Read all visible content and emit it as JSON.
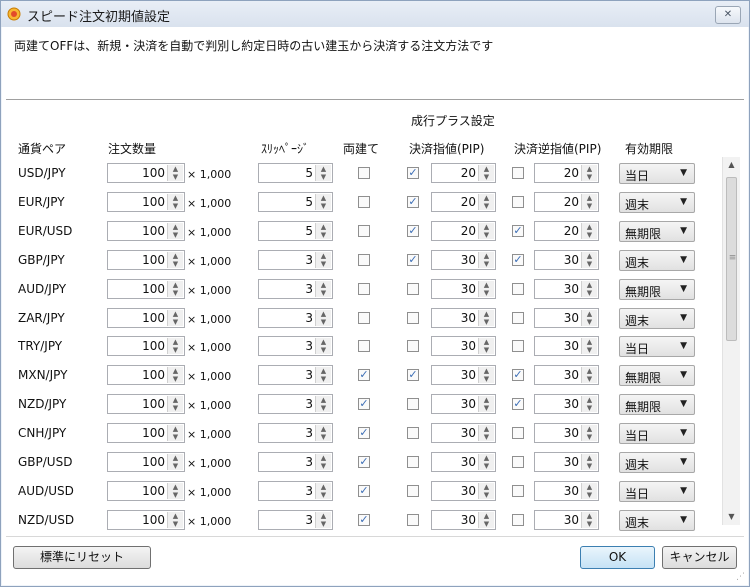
{
  "window": {
    "title": "スピード注文初期値設定",
    "close_label": "✕"
  },
  "description": "両建てOFFは、新規・決済を自動で判別し約定日時の古い建玉から決済する注文方法です",
  "section_header": "成行プラス設定",
  "columns": {
    "pair": "通貨ペア",
    "qty": "注文数量",
    "slippage": "ｽﾘｯﾍﾟｰｼﾞ",
    "hedge": "両建て",
    "limit": "決済指値(PIP)",
    "stop": "決済逆指値(PIP)",
    "expiry": "有効期限"
  },
  "multiplier_label": "× 1,000",
  "rows": [
    {
      "pair": "USD/JPY",
      "qty": "100",
      "slip": "5",
      "hedge": false,
      "limit_on": true,
      "limit": "20",
      "stop_on": false,
      "stop": "20",
      "expiry": "当日"
    },
    {
      "pair": "EUR/JPY",
      "qty": "100",
      "slip": "5",
      "hedge": false,
      "limit_on": true,
      "limit": "20",
      "stop_on": false,
      "stop": "20",
      "expiry": "週末"
    },
    {
      "pair": "EUR/USD",
      "qty": "100",
      "slip": "5",
      "hedge": false,
      "limit_on": true,
      "limit": "20",
      "stop_on": true,
      "stop": "20",
      "expiry": "無期限"
    },
    {
      "pair": "GBP/JPY",
      "qty": "100",
      "slip": "3",
      "hedge": false,
      "limit_on": true,
      "limit": "30",
      "stop_on": true,
      "stop": "30",
      "expiry": "週末"
    },
    {
      "pair": "AUD/JPY",
      "qty": "100",
      "slip": "3",
      "hedge": false,
      "limit_on": false,
      "limit": "30",
      "stop_on": false,
      "stop": "30",
      "expiry": "無期限"
    },
    {
      "pair": "ZAR/JPY",
      "qty": "100",
      "slip": "3",
      "hedge": false,
      "limit_on": false,
      "limit": "30",
      "stop_on": false,
      "stop": "30",
      "expiry": "週末"
    },
    {
      "pair": "TRY/JPY",
      "qty": "100",
      "slip": "3",
      "hedge": false,
      "limit_on": false,
      "limit": "30",
      "stop_on": false,
      "stop": "30",
      "expiry": "当日"
    },
    {
      "pair": "MXN/JPY",
      "qty": "100",
      "slip": "3",
      "hedge": true,
      "limit_on": true,
      "limit": "30",
      "stop_on": true,
      "stop": "30",
      "expiry": "無期限"
    },
    {
      "pair": "NZD/JPY",
      "qty": "100",
      "slip": "3",
      "hedge": true,
      "limit_on": false,
      "limit": "30",
      "stop_on": true,
      "stop": "30",
      "expiry": "無期限"
    },
    {
      "pair": "CNH/JPY",
      "qty": "100",
      "slip": "3",
      "hedge": true,
      "limit_on": false,
      "limit": "30",
      "stop_on": false,
      "stop": "30",
      "expiry": "当日"
    },
    {
      "pair": "GBP/USD",
      "qty": "100",
      "slip": "3",
      "hedge": true,
      "limit_on": false,
      "limit": "30",
      "stop_on": false,
      "stop": "30",
      "expiry": "週末"
    },
    {
      "pair": "AUD/USD",
      "qty": "100",
      "slip": "3",
      "hedge": true,
      "limit_on": false,
      "limit": "30",
      "stop_on": false,
      "stop": "30",
      "expiry": "当日"
    },
    {
      "pair": "NZD/USD",
      "qty": "100",
      "slip": "3",
      "hedge": true,
      "limit_on": false,
      "limit": "30",
      "stop_on": false,
      "stop": "30",
      "expiry": "週末"
    }
  ],
  "buttons": {
    "reset": "標準にリセット",
    "ok": "OK",
    "cancel": "キャンセル"
  },
  "icons": {
    "spinner": "up-down-arrows",
    "checkbox_checked": "checkmark",
    "select": "chevron-down",
    "title": "app-icon"
  }
}
